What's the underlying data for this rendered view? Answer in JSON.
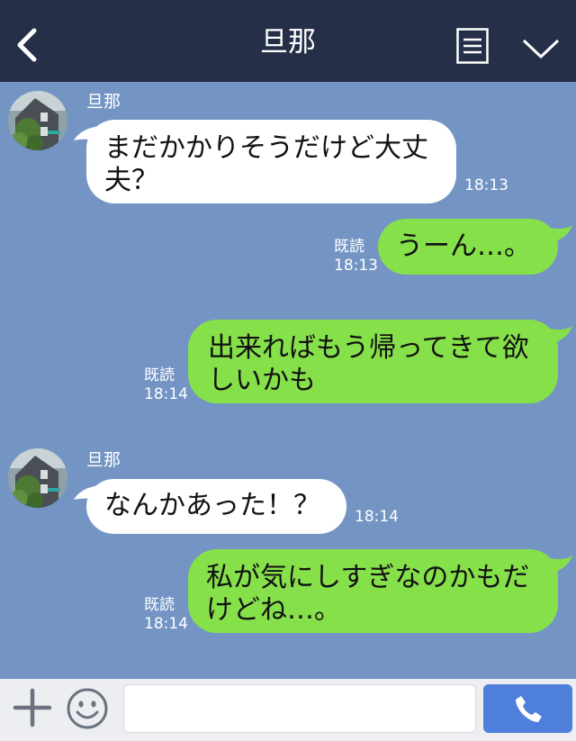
{
  "header": {
    "title": "旦那"
  },
  "colors": {
    "header_bg": "#253048",
    "chat_bg": "#7495c4",
    "outgoing_bubble": "#86e04a",
    "incoming_bubble": "#ffffff",
    "send_button": "#4e7fdb"
  },
  "messages": [
    {
      "from": "other",
      "sender": "旦那",
      "lines": [
        "まだかかりそうだけど大丈",
        "夫？"
      ],
      "time": "18:13"
    },
    {
      "from": "me",
      "lines": [
        "うーん…。"
      ],
      "read": "既読",
      "time": "18:13"
    },
    {
      "from": "me",
      "lines": [
        "出来ればもう帰ってきて欲",
        "しいかも"
      ],
      "read": "既読",
      "time": "18:14"
    },
    {
      "from": "other",
      "sender": "旦那",
      "lines": [
        "なんかあった！？"
      ],
      "time": "18:14"
    },
    {
      "from": "me",
      "lines": [
        "私が気にしすぎなのかもだ",
        "けどね…。"
      ],
      "read": "既読",
      "time": "18:14"
    }
  ],
  "input": {
    "placeholder": ""
  },
  "icons": {
    "back": "chevron-left-icon",
    "menu": "list-icon",
    "collapse": "chevron-down-icon",
    "add": "plus-icon",
    "emoji": "smiley-icon",
    "call": "phone-icon"
  }
}
